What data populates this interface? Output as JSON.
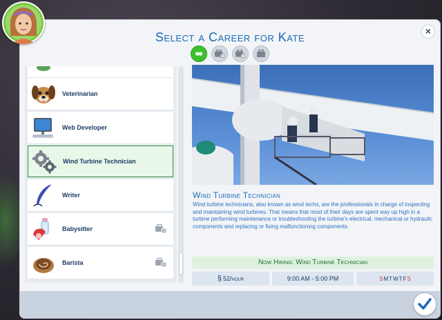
{
  "dialog": {
    "title": "Select a Career for Kate",
    "close_label": "×"
  },
  "filters": [
    {
      "name": "all-careers-filter",
      "icon": "infinity-icon",
      "active": true
    },
    {
      "name": "briefcase-play-filter",
      "icon": "briefcase-play-icon",
      "active": false
    },
    {
      "name": "briefcase-clock-filter",
      "icon": "briefcase-clock-icon",
      "active": false
    },
    {
      "name": "briefcase-filter",
      "icon": "briefcase-icon",
      "active": false
    }
  ],
  "careers": [
    {
      "label": "",
      "icon": "partial-icon",
      "locked": false
    },
    {
      "label": "Veterinarian",
      "icon": "dog-icon",
      "locked": false
    },
    {
      "label": "Web Developer",
      "icon": "computer-icon",
      "locked": false
    },
    {
      "label": "Wind Turbine Technician",
      "icon": "gears-icon",
      "locked": false,
      "selected": true
    },
    {
      "label": "Writer",
      "icon": "quill-icon",
      "locked": false
    },
    {
      "label": "Babysitter",
      "icon": "phone-bottle-icon",
      "locked": true
    },
    {
      "label": "Barista",
      "icon": "coffee-icon",
      "locked": true
    }
  ],
  "detail": {
    "title": "Wind Turbine Technician",
    "description": "Wind turbine technicians, also known as wind techs, are the professionals in charge of inspecting and maintaining wind turbines. That means that most of their days are spent way up high in a turbine performing maintenance or troubleshooting the turbine's electrical, mechanical or hydraulic components and replacing or fixing malfunctioning components.",
    "hiring": "Now Hiring: Wind Turbine Technician",
    "pay_symbol": "§",
    "pay_amount": "52/hour",
    "hours": "9:00 AM - 5:00 PM",
    "days": [
      "S",
      "M",
      "T",
      "W",
      "T",
      "F",
      "S"
    ]
  },
  "colors": {
    "accent": "#1b6ab8",
    "selected_border": "#2d8a3a",
    "weekend_day": "#d23a3a",
    "weekday": "#1e3c66"
  }
}
